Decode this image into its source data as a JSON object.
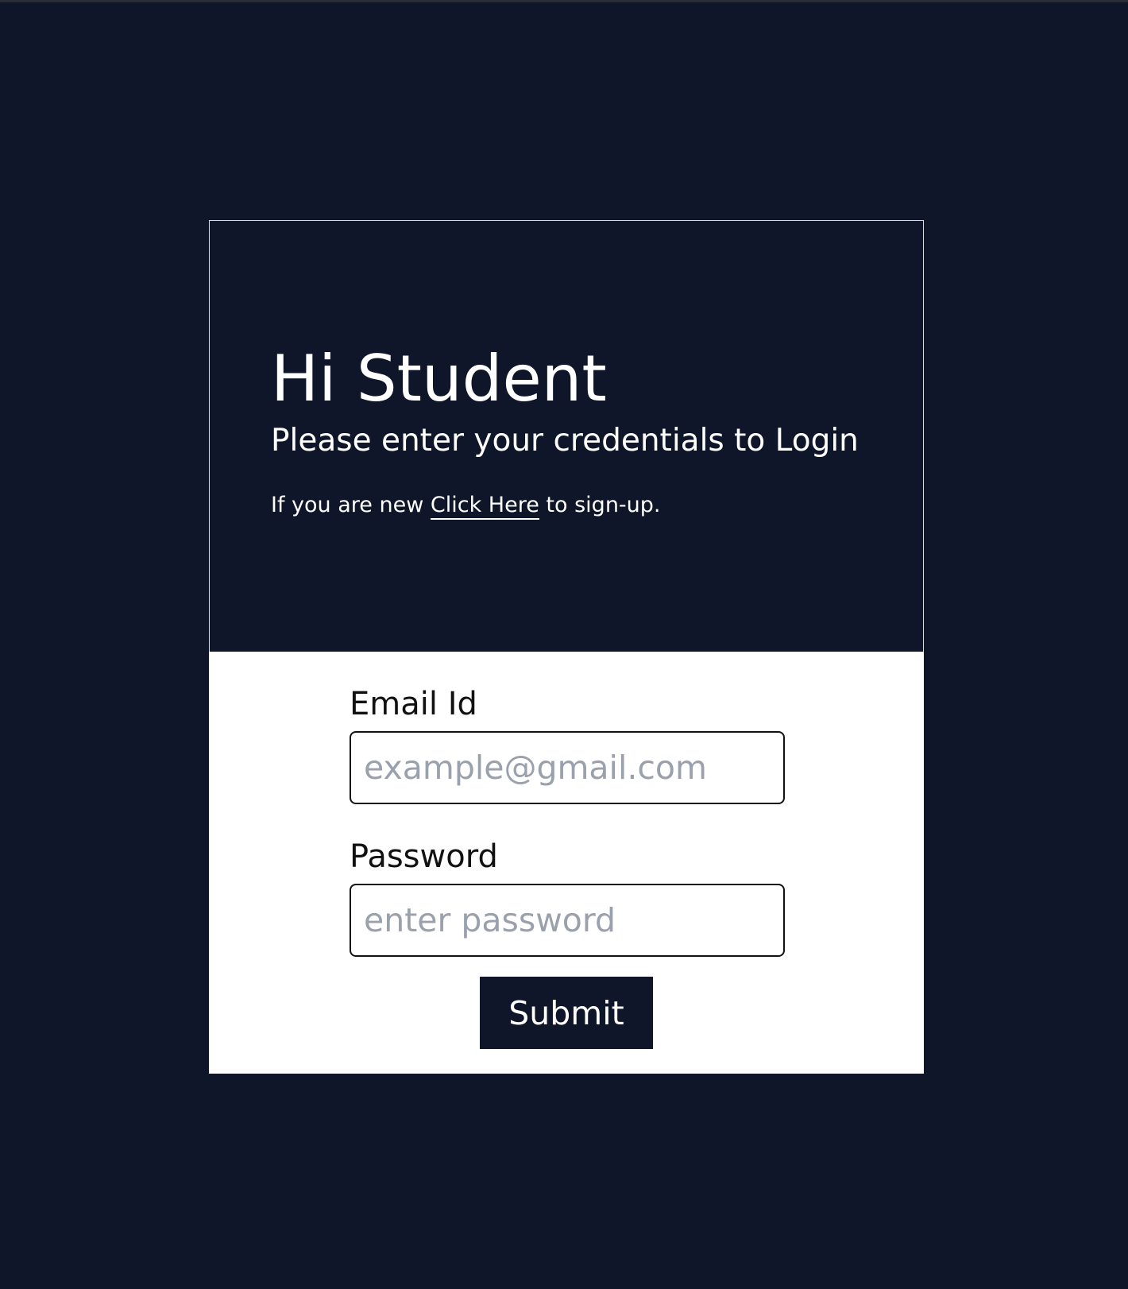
{
  "hero": {
    "title": "Hi Student",
    "subtitle": "Please enter your credentials to Login",
    "signup_prefix": "If you are new ",
    "signup_link": "Click Here",
    "signup_suffix": " to sign-up."
  },
  "form": {
    "email_label": "Email Id",
    "email_placeholder": "example@gmail.com",
    "email_value": "",
    "password_label": "Password",
    "password_placeholder": "enter password",
    "password_value": "",
    "submit_label": "Submit"
  },
  "colors": {
    "background": "#0f1629",
    "hero_text": "#ffffff",
    "form_background": "#ffffff",
    "placeholder": "#9aa1ac",
    "button_background": "#0f1629"
  }
}
